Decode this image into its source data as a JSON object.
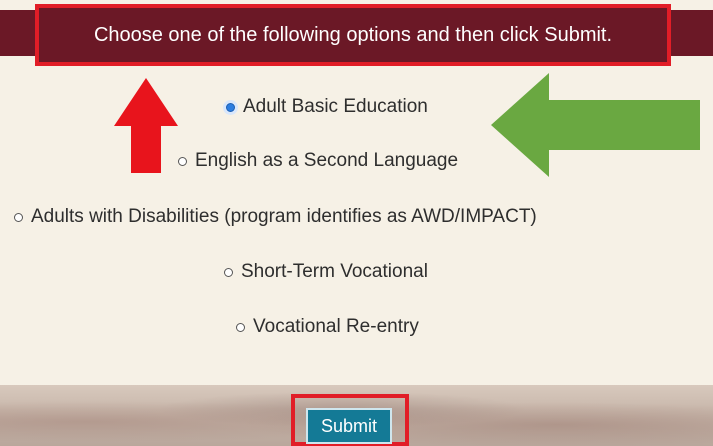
{
  "instruction": "Choose one of the following options and then click Submit.",
  "options": [
    {
      "label": "Adult Basic Education",
      "selected": true
    },
    {
      "label": "English as a Second Language",
      "selected": false
    },
    {
      "label": "Adults with Disabilities (program identifies as AWD/IMPACT)",
      "selected": false
    },
    {
      "label": "Short-Term Vocational",
      "selected": false
    },
    {
      "label": "Vocational Re-entry",
      "selected": false
    }
  ],
  "submit_label": "Submit",
  "colors": {
    "header": "#6b1826",
    "highlight_box": "#e11d27",
    "red_arrow": "#e8141c",
    "green_arrow": "#6aa841",
    "submit_button": "#147a96",
    "background": "#f6f1e6"
  }
}
